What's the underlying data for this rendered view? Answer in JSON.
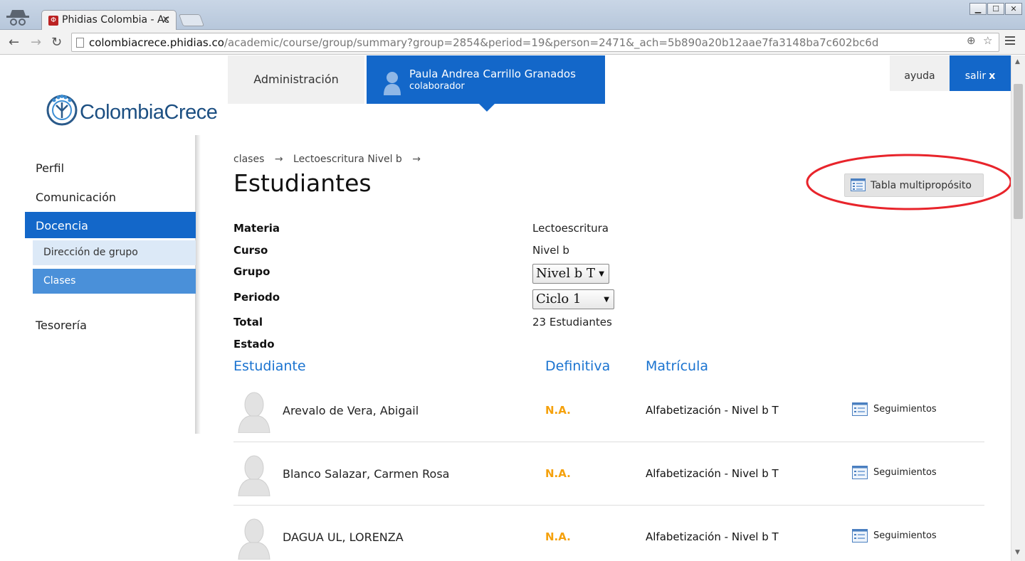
{
  "browser": {
    "tab_title": "Phidias Colombia - Ac",
    "tab_favicon": "Φ",
    "url_host": "colombiacrece.phidias.co",
    "url_path": "/academic/course/group/summary?group=2854&period=19&person=2471&_ach=5b890a20b12aae7fa3148ba7c602bc6d"
  },
  "header": {
    "logo_text": "ColombiaCrece",
    "admin_label": "Administración",
    "user_name": "Paula Andrea Carrillo Granados",
    "user_role": "colaborador",
    "help_label": "ayuda",
    "logout_label": "salir",
    "logout_x": "x"
  },
  "sidebar": {
    "items": [
      {
        "label": "Perfil"
      },
      {
        "label": "Comunicación"
      },
      {
        "label": "Docencia"
      },
      {
        "label": "Dirección de grupo"
      },
      {
        "label": "Clases"
      },
      {
        "label": "Tesorería"
      }
    ]
  },
  "breadcrumb": {
    "items": [
      "clases",
      "Lectoescritura Nivel b"
    ],
    "separator": "→"
  },
  "main": {
    "title": "Estudiantes",
    "multi_button": "Tabla multipropósito",
    "fields": {
      "materia_label": "Materia",
      "materia_value": "Lectoescritura",
      "curso_label": "Curso",
      "curso_value": "Nivel b",
      "grupo_label": "Grupo",
      "grupo_value": "Nivel b T",
      "periodo_label": "Periodo",
      "periodo_value": "Ciclo 1",
      "total_label": "Total",
      "total_value": "23 Estudiantes",
      "estado_label": "Estado"
    },
    "columns": [
      "Estudiante",
      "Definitiva",
      "Matrícula"
    ],
    "students": [
      {
        "name": "Arevalo de Vera, Abigail",
        "grade": "N.A.",
        "enrollment": "Alfabetización - Nivel b T",
        "action": "Seguimientos"
      },
      {
        "name": "Blanco Salazar, Carmen Rosa",
        "grade": "N.A.",
        "enrollment": "Alfabetización - Nivel b T",
        "action": "Seguimientos"
      },
      {
        "name": "DAGUA UL, LORENZA",
        "grade": "N.A.",
        "enrollment": "Alfabetización - Nivel b T",
        "action": "Seguimientos"
      }
    ]
  },
  "colors": {
    "brand_blue": "#1367c9",
    "header_blue": "#1a73d0",
    "grade_orange": "#f5a10c",
    "highlight_red": "#e8242b"
  }
}
